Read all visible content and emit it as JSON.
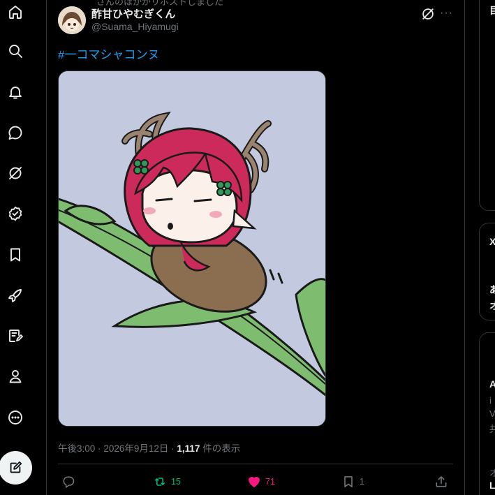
{
  "nav": {
    "items": [
      {
        "name": "home-icon"
      },
      {
        "name": "search-icon"
      },
      {
        "name": "notifications-icon"
      },
      {
        "name": "messages-icon"
      },
      {
        "name": "grok-icon"
      },
      {
        "name": "verified-icon"
      },
      {
        "name": "bookmarks-icon"
      },
      {
        "name": "rocket-icon"
      },
      {
        "name": "lists-icon"
      },
      {
        "name": "profile-icon"
      },
      {
        "name": "more-icon"
      }
    ],
    "compose_icon": "compose-icon"
  },
  "post": {
    "repost_hint": "さんのほかがリポストしました",
    "author": {
      "display_name": "酢甘ひやむぎくん",
      "handle": "@Suama_Hiyamugi"
    },
    "text": "#一コマシャコンヌ",
    "media": {
      "description_icon": "illustration-image",
      "background": "#c3c9df"
    },
    "time": "午後3:00",
    "date": "2026年9月12日",
    "separator": "·",
    "views_count": "1,117",
    "views_label": " 件の表示",
    "actions": {
      "reply_count": "",
      "repost_count": "15",
      "like_count": "71",
      "bookmark_count": "1"
    }
  },
  "sidebar": {
    "fragments": [
      "目",
      "X",
      "あ",
      "オ",
      "A",
      "i",
      "V",
      "共",
      "オ",
      "L"
    ]
  },
  "colors": {
    "accent": "#1d9bf0",
    "repost": "#00ba7c",
    "like": "#f91880",
    "muted": "#71767b",
    "text": "#e7e9ea",
    "border": "#2f3336"
  }
}
